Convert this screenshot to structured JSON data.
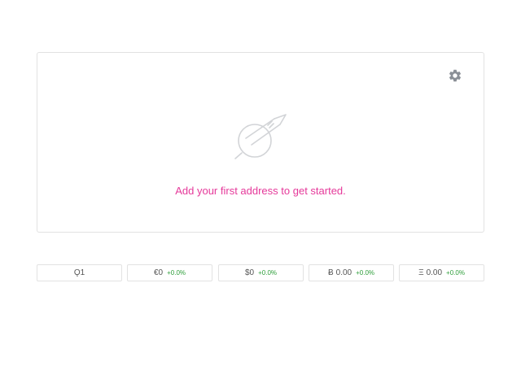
{
  "settings": {
    "icon": "gear-icon"
  },
  "empty_state": {
    "icon": "planet-rocket-icon",
    "message": "Add your first address to get started."
  },
  "tickers": [
    {
      "symbol": "Ǫ",
      "value": "1",
      "change": ""
    },
    {
      "symbol": "€",
      "value": "0",
      "change": "+0.0%"
    },
    {
      "symbol": "$",
      "value": "0",
      "change": "+0.0%"
    },
    {
      "symbol": "Ƀ",
      "value": "0.00",
      "change": "+0.0%"
    },
    {
      "symbol": "Ξ",
      "value": "0.00",
      "change": "+0.0%"
    }
  ],
  "colors": {
    "accent": "#e5399a",
    "positive": "#2e9e3a",
    "icon_gray": "#8a8f96"
  }
}
